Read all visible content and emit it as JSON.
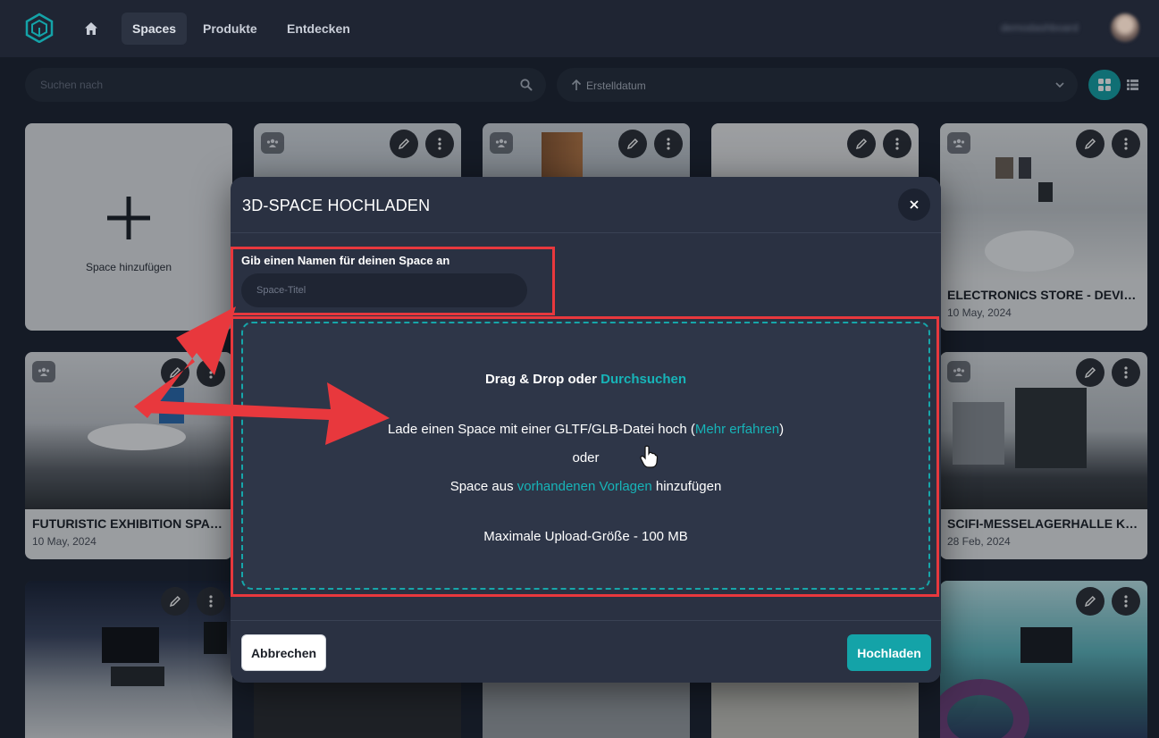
{
  "nav": {
    "tabs": [
      {
        "label": "Spaces"
      },
      {
        "label": "Produkte"
      },
      {
        "label": "Entdecken"
      }
    ],
    "user_name": "demodashboard"
  },
  "toolbar": {
    "search_placeholder": "Suchen nach",
    "sort_label": "Erstelldatum",
    "view_mode": "grid"
  },
  "add_card": {
    "label": "Space hinzufügen"
  },
  "cards": [
    {
      "title": "ELECTRONICS STORE - DEVICE...",
      "date": "10 May, 2024"
    },
    {
      "title": "FUTURISTIC EXHIBITION SPACE",
      "date": "10 May, 2024"
    },
    {
      "title": "SCIFI-MESSELAGERHALLE KON...",
      "date": "28 Feb, 2024"
    }
  ],
  "modal": {
    "title": "3D-SPACE HOCHLADEN",
    "name_label": "Gib einen Namen für deinen Space an",
    "name_placeholder": "Space-Titel",
    "dropzone": {
      "drag_text": "Drag & Drop oder ",
      "browse_link": "Durchsuchen",
      "upload_text_before": "Lade einen Space mit einer GLTF/GLB-Datei hoch (",
      "learn_more_link": "Mehr erfahren",
      "upload_text_after": ")",
      "or_text": "oder",
      "template_before": "Space aus ",
      "template_link": "vorhandenen Vorlagen",
      "template_after": " hinzufügen",
      "max_size": "Maximale Upload-Größe - 100 MB"
    },
    "cancel_label": "Abbrechen",
    "upload_label": "Hochladen"
  },
  "colors": {
    "accent": "#14a3a8",
    "annotation_red": "#e8383d",
    "background": "#1c2230",
    "modal": "#2a3142"
  }
}
